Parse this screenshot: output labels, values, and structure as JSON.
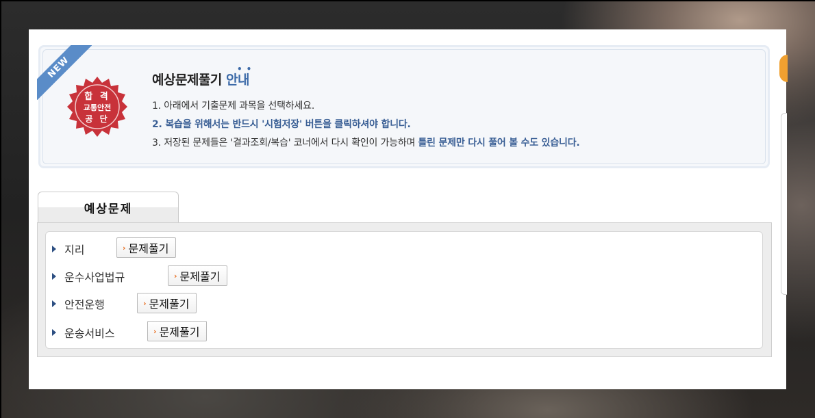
{
  "info": {
    "ribbon": "NEW",
    "seal": {
      "line1": "합 격",
      "line2": "교통안전",
      "line3": "공 단"
    },
    "title_main": "예상문제풀기",
    "title_accent": "안내",
    "line1": "1. 아래에서 기출문제 과목을 선택하세요.",
    "line2": "2. 복습을 위해서는 반드시 '시험저장' 버튼을 클릭하셔야 합니다.",
    "line3_start": "3. 저장된 문제들은 '결과조회/복습' 코너에서 다시 확인이 가능하며 ",
    "line3_highlight": "틀린 문제만 다시 풀어 볼 수도 있습니다."
  },
  "tab": {
    "label": "예상문제"
  },
  "subjects": [
    {
      "label": "지리",
      "button": "문제풀기"
    },
    {
      "label": "운수사업법규",
      "button": "문제풀기"
    },
    {
      "label": "안전운행",
      "button": "문제풀기"
    },
    {
      "label": "운송서비스",
      "button": "문제풀기"
    }
  ],
  "colors": {
    "accent": "#3a5f95",
    "ribbon": "#5a8cc8",
    "seal": "#c8323a",
    "button_chevron": "#e86b1c"
  }
}
